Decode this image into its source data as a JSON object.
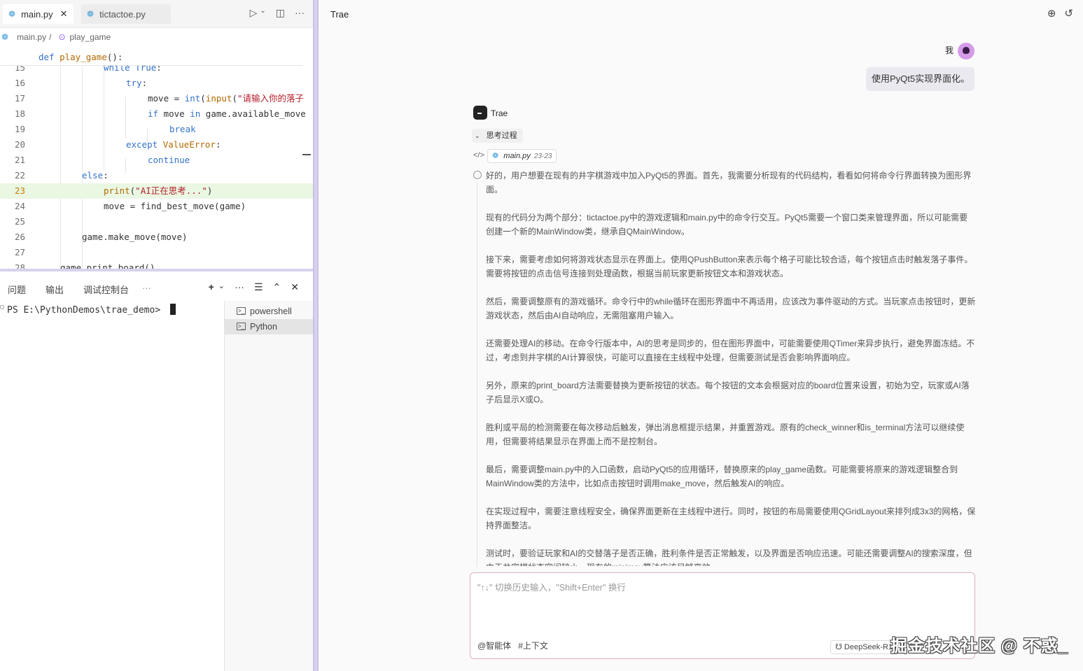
{
  "editor": {
    "tabs": [
      {
        "label": "main.py",
        "close": "✕"
      },
      {
        "label": "tictactoe.py"
      }
    ],
    "breadcrumb": {
      "file": "main.py",
      "sep": "/",
      "symbol": "play_game"
    },
    "sticky": {
      "kw": "def ",
      "name": "play_game",
      "rest": "():"
    },
    "lines": [
      {
        "n": "15",
        "indent": 93,
        "html": [
          {
            "c": "kw",
            "t": "while "
          },
          {
            "c": "kw",
            "t": "True"
          },
          {
            "c": "",
            "t": ":"
          }
        ]
      },
      {
        "n": "16",
        "indent": 125,
        "html": [
          {
            "c": "kw",
            "t": "try"
          },
          {
            "c": "",
            "t": ":"
          }
        ]
      },
      {
        "n": "17",
        "indent": 156,
        "html": [
          {
            "c": "",
            "t": "move = "
          },
          {
            "c": "kw",
            "t": "int"
          },
          {
            "c": "",
            "t": "("
          },
          {
            "c": "fn",
            "t": "input"
          },
          {
            "c": "",
            "t": "("
          },
          {
            "c": "st",
            "t": "\"请输入你的落子"
          }
        ]
      },
      {
        "n": "18",
        "indent": 156,
        "html": [
          {
            "c": "kw",
            "t": "if "
          },
          {
            "c": "",
            "t": "move "
          },
          {
            "c": "kw",
            "t": "in "
          },
          {
            "c": "",
            "t": "game.available_move"
          }
        ]
      },
      {
        "n": "19",
        "indent": 187,
        "html": [
          {
            "c": "kw",
            "t": "break"
          }
        ]
      },
      {
        "n": "20",
        "indent": 125,
        "html": [
          {
            "c": "kw",
            "t": "except "
          },
          {
            "c": "fn",
            "t": "ValueError"
          },
          {
            "c": "",
            "t": ":"
          }
        ]
      },
      {
        "n": "21",
        "indent": 156,
        "html": [
          {
            "c": "kw",
            "t": "continue"
          }
        ]
      },
      {
        "n": "22",
        "indent": 62,
        "html": [
          {
            "c": "kw",
            "t": "else"
          },
          {
            "c": "",
            "t": ":"
          }
        ]
      },
      {
        "n": "23",
        "indent": 93,
        "html": [
          {
            "c": "fn",
            "t": "print"
          },
          {
            "c": "",
            "t": "("
          },
          {
            "c": "st",
            "t": "\"AI正在思考...\""
          },
          {
            "c": "",
            "t": ")"
          }
        ]
      },
      {
        "n": "24",
        "indent": 93,
        "html": [
          {
            "c": "",
            "t": "move = find_best_move(game)"
          }
        ]
      },
      {
        "n": "25",
        "indent": 0,
        "html": []
      },
      {
        "n": "26",
        "indent": 62,
        "html": [
          {
            "c": "",
            "t": "game.make_move(move)"
          }
        ]
      },
      {
        "n": "27",
        "indent": 0,
        "html": []
      },
      {
        "n": "28",
        "indent": 31,
        "html": [
          {
            "c": "",
            "t": "game.print_board()"
          }
        ]
      }
    ],
    "current_line": "23"
  },
  "panel": {
    "tabs": [
      "问题",
      "输出",
      "调试控制台",
      "···"
    ],
    "tools": [
      "+",
      "⌄",
      "···",
      "☰",
      "⌃",
      "✕"
    ],
    "prompt": "PS E:\\PythonDemos\\trae_demo> ",
    "terminals": [
      {
        "label": "powershell",
        "selected": false
      },
      {
        "label": "Python",
        "selected": true
      }
    ]
  },
  "chat": {
    "title": "Trae",
    "user_name": "我",
    "user_message": "使用PyQt5实现界面化。",
    "bot_name": "Trae",
    "thinking_label": "思考过程",
    "file_ref": {
      "name": "main.py",
      "range": "23-23"
    },
    "thinking": [
      "好的，用户想要在现有的井字棋游戏中加入PyQt5的界面。首先，我需要分析现有的代码结构，看看如何将命令行界面转换为图形界面。",
      "现有的代码分为两个部分：tictactoe.py中的游戏逻辑和main.py中的命令行交互。PyQt5需要一个窗口类来管理界面，所以可能需要创建一个新的MainWindow类，继承自QMainWindow。",
      "接下来，需要考虑如何将游戏状态显示在界面上。使用QPushButton来表示每个格子可能比较合适，每个按钮点击时触发落子事件。需要将按钮的点击信号连接到处理函数，根据当前玩家更新按钮文本和游戏状态。",
      "然后，需要调整原有的游戏循环。命令行中的while循环在图形界面中不再适用，应该改为事件驱动的方式。当玩家点击按钮时，更新游戏状态，然后由AI自动响应，无需阻塞用户输入。",
      "还需要处理AI的移动。在命令行版本中，AI的思考是同步的，但在图形界面中，可能需要使用QTimer来异步执行，避免界面冻结。不过，考虑到井字棋的AI计算很快，可能可以直接在主线程中处理，但需要测试是否会影响界面响应。",
      "另外，原来的print_board方法需要替换为更新按钮的状态。每个按钮的文本会根据对应的board位置来设置，初始为空，玩家或AI落子后显示X或O。",
      "胜利或平局的检测需要在每次移动后触发，弹出消息框提示结果，并重置游戏。原有的check_winner和is_terminal方法可以继续使用，但需要将结果显示在界面上而不是控制台。",
      "最后，需要调整main.py中的入口函数，启动PyQt5的应用循环，替换原来的play_game函数。可能需要将原来的游戏逻辑整合到MainWindow类的方法中，比如点击按钮时调用make_move，然后触发AI的响应。",
      "在实现过程中，需要注意线程安全，确保界面更新在主线程中进行。同时，按钮的布局需要使用QGridLayout来排列成3x3的网格，保持界面整洁。",
      "测试时，要验证玩家和AI的交替落子是否正确，胜利条件是否正常触发，以及界面是否响应迅速。可能还需要调整AI的搜索深度，但由于井字棋状态空间较小，现有的minimax算法应该足够高效。"
    ],
    "input_placeholder": "\"↑↓\" 切换历史输入，\"Shift+Enter\" 换行",
    "chips": [
      "@智能体",
      "#上下文"
    ],
    "model": "DeepSeek-R1",
    "watermark": "掘金技术社区 @ 不惑_"
  }
}
